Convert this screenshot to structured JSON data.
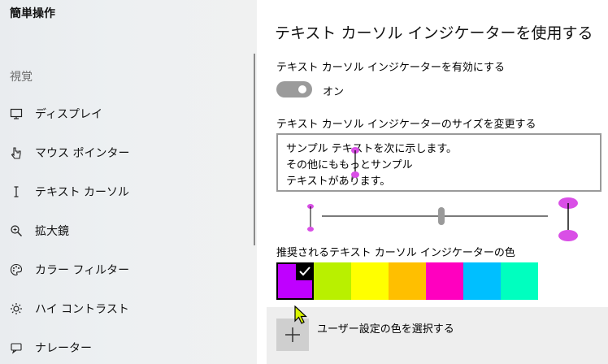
{
  "sidebar": {
    "app_title": "簡単操作",
    "section": "視覚",
    "items": [
      {
        "label": "ディスプレイ",
        "icon": "monitor-icon"
      },
      {
        "label": "マウス ポインター",
        "icon": "mouse-pointer-icon"
      },
      {
        "label": "テキスト カーソル",
        "icon": "text-cursor-icon"
      },
      {
        "label": "拡大鏡",
        "icon": "magnifier-icon"
      },
      {
        "label": "カラー フィルター",
        "icon": "palette-icon"
      },
      {
        "label": "ハイ コントラスト",
        "icon": "sun-icon"
      },
      {
        "label": "ナレーター",
        "icon": "narrator-icon"
      }
    ]
  },
  "main": {
    "title": "テキスト カーソル インジケーターを使用する",
    "enable_label": "テキスト カーソル インジケーターを有効にする",
    "toggle": {
      "state": "オン",
      "on": true
    },
    "size_label": "テキスト カーソル インジケーターのサイズを変更する",
    "sample_lines": [
      "サンプル テキストを次に示します。",
      "その他にももっとサンプル",
      "テキストがあります。"
    ],
    "slider_level": 0.53,
    "color_label": "推奨されるテキスト カーソル インジケーターの色",
    "swatches": [
      "#bf00ff",
      "#b9f000",
      "#ffff00",
      "#ffbf00",
      "#ff00bf",
      "#00bfff",
      "#00ffbf"
    ],
    "selected_swatch": 0,
    "custom_label": "ユーザー設定の色を選択する",
    "indicator_color": "#d94fe6"
  }
}
